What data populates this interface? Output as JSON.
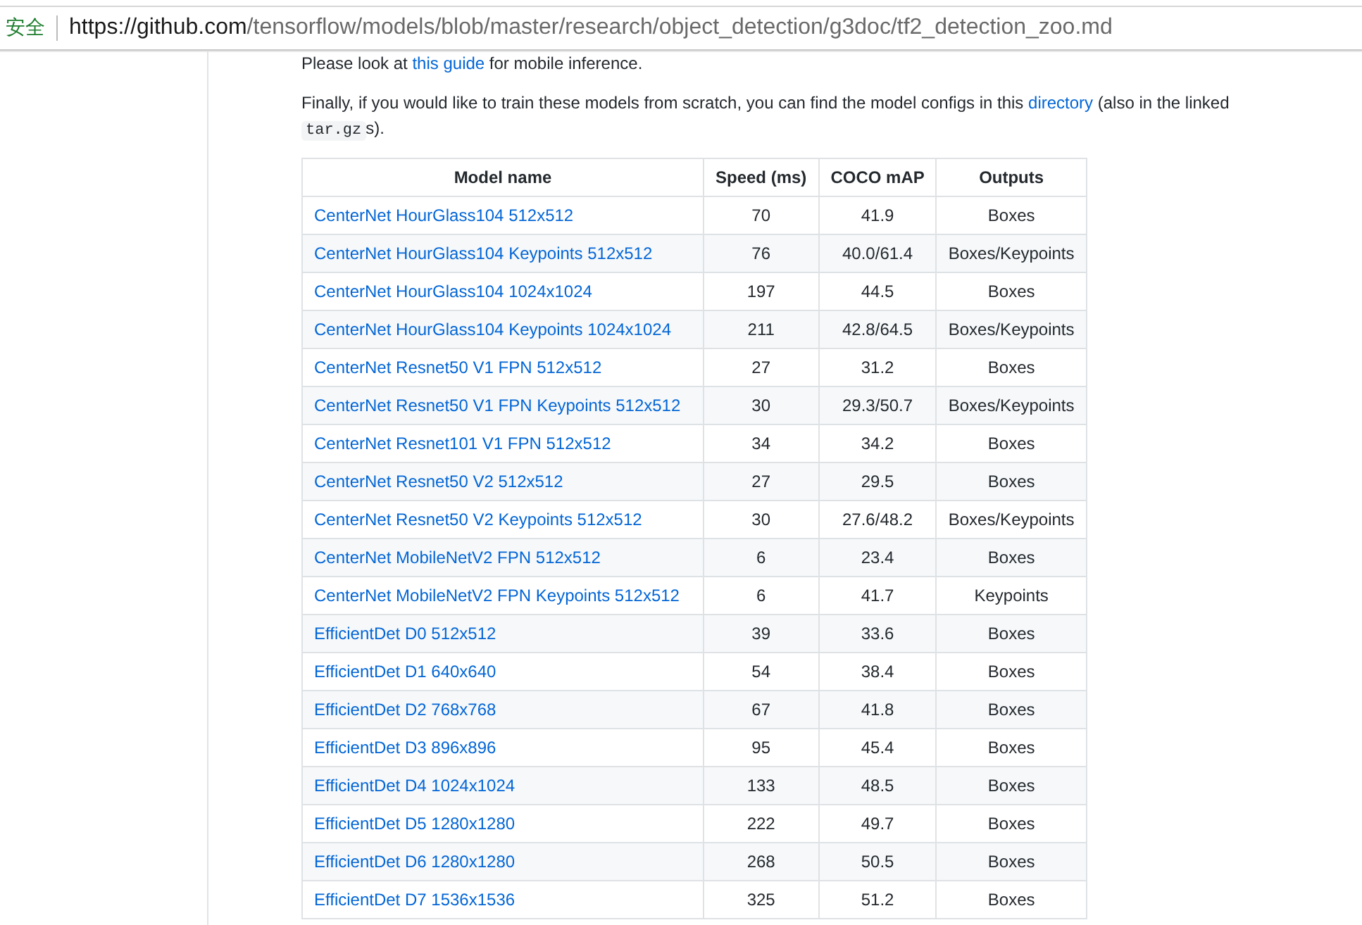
{
  "address_bar": {
    "security_label": "安全",
    "url_host": "https://github.com",
    "url_path": "/tensorflow/models/blob/master/research/object_detection/g3doc/tf2_detection_zoo.md"
  },
  "paragraphs": [
    [
      {
        "kind": "text",
        "text": "Please look at "
      },
      {
        "kind": "link",
        "text": "this guide"
      },
      {
        "kind": "text",
        "text": " for mobile inference."
      }
    ],
    [
      {
        "kind": "text",
        "text": "Finally, if you would like to train these models from scratch, you can find the model configs in this "
      },
      {
        "kind": "link",
        "text": "directory"
      },
      {
        "kind": "text",
        "text": " (also in the linked "
      },
      {
        "kind": "code",
        "text": "tar.gz"
      },
      {
        "kind": "text",
        "text": "s)."
      }
    ]
  ],
  "table": {
    "columns": [
      "Model name",
      "Speed (ms)",
      "COCO mAP",
      "Outputs"
    ],
    "rows": [
      [
        "CenterNet HourGlass104 512x512",
        "70",
        "41.9",
        "Boxes"
      ],
      [
        "CenterNet HourGlass104 Keypoints 512x512",
        "76",
        "40.0/61.4",
        "Boxes/Keypoints"
      ],
      [
        "CenterNet HourGlass104 1024x1024",
        "197",
        "44.5",
        "Boxes"
      ],
      [
        "CenterNet HourGlass104 Keypoints 1024x1024",
        "211",
        "42.8/64.5",
        "Boxes/Keypoints"
      ],
      [
        "CenterNet Resnet50 V1 FPN 512x512",
        "27",
        "31.2",
        "Boxes"
      ],
      [
        "CenterNet Resnet50 V1 FPN Keypoints 512x512",
        "30",
        "29.3/50.7",
        "Boxes/Keypoints"
      ],
      [
        "CenterNet Resnet101 V1 FPN 512x512",
        "34",
        "34.2",
        "Boxes"
      ],
      [
        "CenterNet Resnet50 V2 512x512",
        "27",
        "29.5",
        "Boxes"
      ],
      [
        "CenterNet Resnet50 V2 Keypoints 512x512",
        "30",
        "27.6/48.2",
        "Boxes/Keypoints"
      ],
      [
        "CenterNet MobileNetV2 FPN 512x512",
        "6",
        "23.4",
        "Boxes"
      ],
      [
        "CenterNet MobileNetV2 FPN Keypoints 512x512",
        "6",
        "41.7",
        "Keypoints"
      ],
      [
        "EfficientDet D0 512x512",
        "39",
        "33.6",
        "Boxes"
      ],
      [
        "EfficientDet D1 640x640",
        "54",
        "38.4",
        "Boxes"
      ],
      [
        "EfficientDet D2 768x768",
        "67",
        "41.8",
        "Boxes"
      ],
      [
        "EfficientDet D3 896x896",
        "95",
        "45.4",
        "Boxes"
      ],
      [
        "EfficientDet D4 1024x1024",
        "133",
        "48.5",
        "Boxes"
      ],
      [
        "EfficientDet D5 1280x1280",
        "222",
        "49.7",
        "Boxes"
      ],
      [
        "EfficientDet D6 1280x1280",
        "268",
        "50.5",
        "Boxes"
      ],
      [
        "EfficientDet D7 1536x1536",
        "325",
        "51.2",
        "Boxes"
      ]
    ]
  }
}
